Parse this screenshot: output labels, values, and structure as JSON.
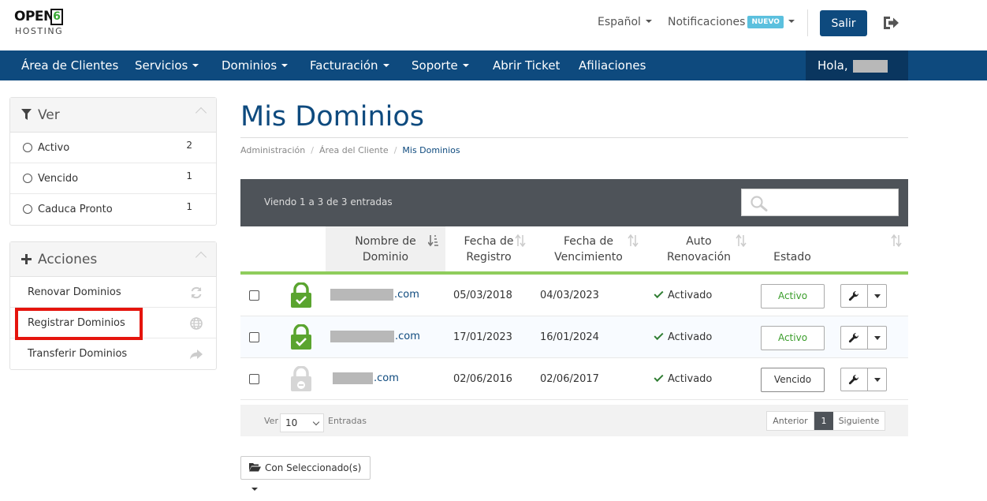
{
  "header": {
    "logo_text": "OPEN",
    "logo_digit": "6",
    "logo_sub": "HOSTING",
    "language": "Español",
    "notifications": "Notificaciones",
    "new_badge": "NUEVO",
    "logout_label": "Salir"
  },
  "nav": {
    "items": [
      "Área de Clientes",
      "Servicios",
      "Dominios",
      "Facturación",
      "Soporte",
      "Abrir Ticket",
      "Afiliaciones"
    ],
    "greeting": "Hola,"
  },
  "sidebar": {
    "ver": {
      "title": "Ver",
      "items": [
        {
          "label": "Activo",
          "count": "2"
        },
        {
          "label": "Vencido",
          "count": "1"
        },
        {
          "label": "Caduca Pronto",
          "count": "1"
        }
      ]
    },
    "acciones": {
      "title": "Acciones",
      "items": [
        {
          "label": "Renovar Dominios",
          "icon": "refresh-icon"
        },
        {
          "label": "Registrar Dominios",
          "icon": "globe-icon"
        },
        {
          "label": "Transferir Dominios",
          "icon": "share-arrow-icon"
        }
      ]
    }
  },
  "main": {
    "title": "Mis Dominios",
    "breadcrumb": [
      "Administración",
      "Área del Cliente",
      "Mis Dominios"
    ],
    "table_info": "Viendo 1 a 3 de 3 entradas",
    "columns": {
      "nombre_l1": "Nombre de",
      "nombre_l2": "Dominio",
      "registro_l1": "Fecha de",
      "registro_l2": "Registro",
      "venc_l1": "Fecha de",
      "venc_l2": "Vencimiento",
      "auto_l1": "Auto",
      "auto_l2": "Renovación",
      "estado": "Estado"
    },
    "rows": [
      {
        "tld": ".com",
        "registro": "05/03/2018",
        "vencimiento": "04/03/2023",
        "auto": "Activado",
        "estado": "Activo",
        "lock": "green"
      },
      {
        "tld": ".com",
        "registro": "17/01/2023",
        "vencimiento": "16/01/2024",
        "auto": "Activado",
        "estado": "Activo",
        "lock": "green"
      },
      {
        "tld": ".com",
        "registro": "02/06/2016",
        "vencimiento": "02/06/2017",
        "auto": "Activado",
        "estado": "Vencido",
        "lock": "grey"
      }
    ],
    "footer": {
      "ver": "Ver",
      "page_length": "10",
      "entradas": "Entradas",
      "prev": "Anterior",
      "page": "1",
      "next": "Siguiente"
    },
    "bulk_button": "Con Seleccionado(s)"
  },
  "colors": {
    "brand": "#0e4a7e",
    "nav_dark": "#0a365f",
    "accent_green": "#8fcd5c",
    "active_green": "#3a9d2a",
    "highlight_red": "#e5140d"
  }
}
